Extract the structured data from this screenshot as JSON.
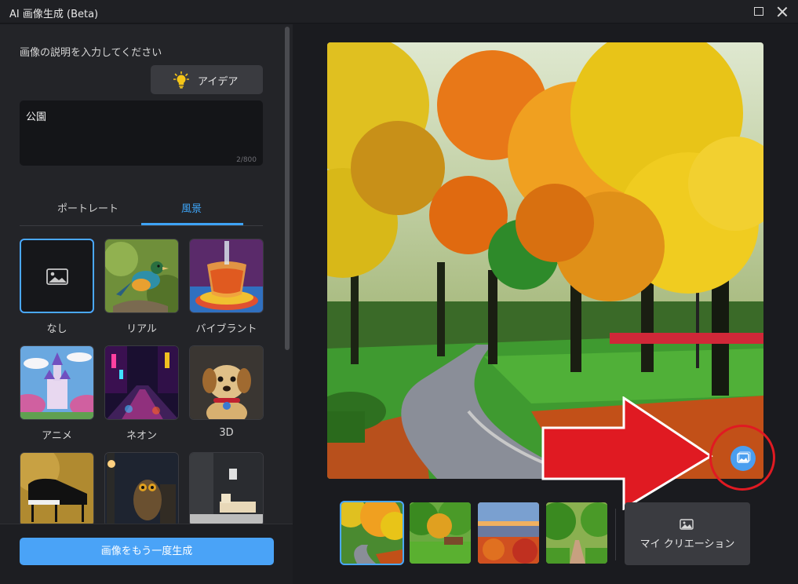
{
  "window": {
    "title": "AI 画像生成 (Beta)"
  },
  "left_panel": {
    "prompt_label": "画像の説明を入力してください",
    "idea_button": "アイデア",
    "prompt_value": "公園",
    "char_counter": "2/800",
    "tabs": [
      {
        "label": "ポートレート",
        "active": false
      },
      {
        "label": "風景",
        "active": true
      }
    ],
    "styles": [
      {
        "label": "なし",
        "selected": true
      },
      {
        "label": "リアル",
        "selected": false
      },
      {
        "label": "バイブラント",
        "selected": false
      },
      {
        "label": "アニメ",
        "selected": false
      },
      {
        "label": "ネオン",
        "selected": false
      },
      {
        "label": "3D",
        "selected": false
      },
      {
        "label": "",
        "selected": false
      },
      {
        "label": "",
        "selected": false
      },
      {
        "label": "",
        "selected": false
      }
    ],
    "regenerate_button": "画像をもう一度生成"
  },
  "preview": {
    "thumbnails": [
      {
        "selected": true
      },
      {
        "selected": false
      },
      {
        "selected": false
      },
      {
        "selected": false
      }
    ],
    "my_creations_button": "マイ クリエーション"
  },
  "colors": {
    "accent": "#4aa3f7",
    "annotation_red": "#e01a22",
    "background": "#1a1b1f",
    "panel": "#232428"
  },
  "icons": {
    "idea": "lightbulb-icon",
    "none_style": "image-placeholder-icon",
    "gallery": "gallery-icon",
    "my_creations": "image-icon"
  }
}
